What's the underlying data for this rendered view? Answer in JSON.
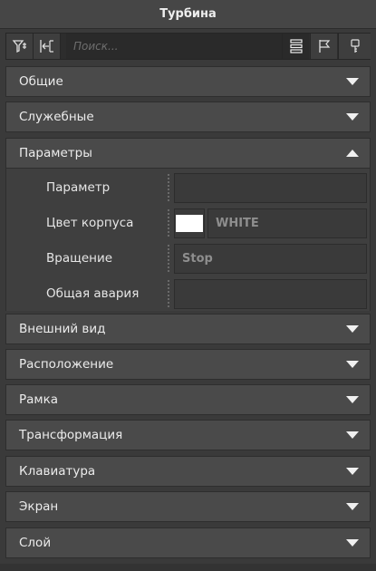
{
  "panel": {
    "title": "Турбина"
  },
  "toolbar": {
    "search_placeholder": "Поиск...",
    "buttons": [
      "filter-icon",
      "import-icon",
      "list-icon",
      "flag-icon",
      "key-icon"
    ]
  },
  "sections": {
    "general": "Общие",
    "service": "Служебные",
    "parameters": "Параметры",
    "appearance": "Внешний вид",
    "location": "Расположение",
    "frame": "Рамка",
    "transform": "Трансформация",
    "keyboard": "Клавиатура",
    "screen": "Экран",
    "layer": "Слой"
  },
  "params": {
    "param": {
      "label": "Параметр",
      "value": ""
    },
    "body_color": {
      "label": "Цвет корпуса",
      "value": "WHITE",
      "swatch": "#ffffff"
    },
    "rotation": {
      "label": "Вращение",
      "value": "Stop"
    },
    "general_alarm": {
      "label": "Общая авария",
      "value": ""
    }
  }
}
